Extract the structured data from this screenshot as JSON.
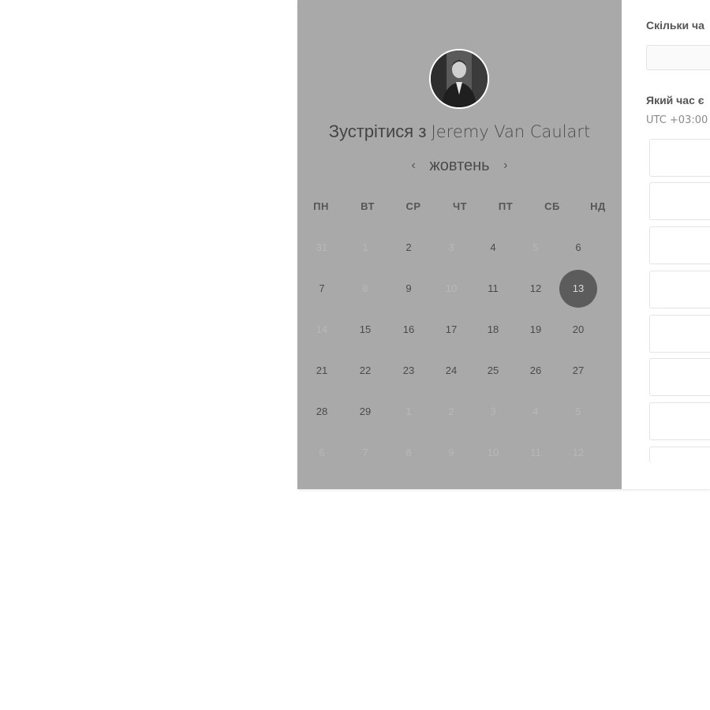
{
  "booking": {
    "title_prefix": "Зустрітися з",
    "host_name": "Jeremy Van Caulart",
    "avatar_icon": "person-photo-icon"
  },
  "calendar": {
    "month": "жовтень",
    "prev_icon": "chevron-left-icon",
    "next_icon": "chevron-right-icon",
    "prev_symbol": "‹",
    "next_symbol": "›",
    "weekdays": [
      "ПН",
      "ВТ",
      "СР",
      "ЧТ",
      "ПТ",
      "СБ",
      "НД"
    ],
    "weeks": [
      [
        {
          "d": "31",
          "m": true
        },
        {
          "d": "1",
          "m": true
        },
        {
          "d": "2"
        },
        {
          "d": "3",
          "m": true
        },
        {
          "d": "4"
        },
        {
          "d": "5",
          "m": true
        },
        {
          "d": "6"
        }
      ],
      [
        {
          "d": "7"
        },
        {
          "d": "8",
          "m": true
        },
        {
          "d": "9"
        },
        {
          "d": "10",
          "m": true
        },
        {
          "d": "11"
        },
        {
          "d": "12"
        },
        {
          "d": "13",
          "s": true
        }
      ],
      [
        {
          "d": "14",
          "m": true
        },
        {
          "d": "15"
        },
        {
          "d": "16"
        },
        {
          "d": "17"
        },
        {
          "d": "18"
        },
        {
          "d": "19"
        },
        {
          "d": "20"
        }
      ],
      [
        {
          "d": "21"
        },
        {
          "d": "22"
        },
        {
          "d": "23"
        },
        {
          "d": "24"
        },
        {
          "d": "25"
        },
        {
          "d": "26"
        },
        {
          "d": "27"
        }
      ],
      [
        {
          "d": "28"
        },
        {
          "d": "29"
        },
        {
          "d": "1",
          "m": true
        },
        {
          "d": "2",
          "m": true
        },
        {
          "d": "3",
          "m": true
        },
        {
          "d": "4",
          "m": true
        },
        {
          "d": "5",
          "m": true
        }
      ],
      [
        {
          "d": "6",
          "m": true
        },
        {
          "d": "7",
          "m": true
        },
        {
          "d": "8",
          "m": true
        },
        {
          "d": "9",
          "m": true
        },
        {
          "d": "10",
          "m": true
        },
        {
          "d": "11",
          "m": true
        },
        {
          "d": "12",
          "m": true
        }
      ]
    ],
    "selected_day": "13"
  },
  "form": {
    "duration_question": "Скільки ча",
    "duration_value": "",
    "time_question": "Який час є",
    "timezone": "UTC +03:00"
  },
  "colors": {
    "panel_bg": "#a9a9a9",
    "selected_day_bg": "#5c5c5c",
    "muted_day": "#b8b8b8"
  }
}
